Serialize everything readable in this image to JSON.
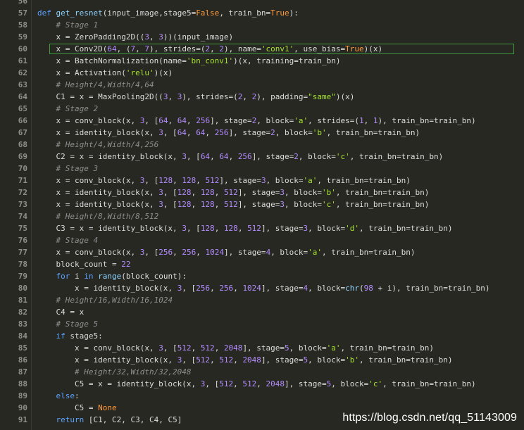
{
  "editor": {
    "lines": [
      {
        "num": "56",
        "tokens": []
      },
      {
        "num": "57",
        "tokens": [
          [
            "k",
            "def "
          ],
          [
            "f",
            "get_resnet"
          ],
          [
            "p",
            "(input_image,stage5="
          ],
          [
            "b",
            "False"
          ],
          [
            "p",
            ", train_bn="
          ],
          [
            "b",
            "True"
          ],
          [
            "p",
            "):"
          ]
        ]
      },
      {
        "num": "58",
        "tokens": [
          [
            "p",
            "    "
          ],
          [
            "c",
            "# Stage 1"
          ]
        ]
      },
      {
        "num": "59",
        "tokens": [
          [
            "p",
            "    x = ZeroPadding2D(("
          ],
          [
            "n",
            "3"
          ],
          [
            "p",
            ", "
          ],
          [
            "n",
            "3"
          ],
          [
            "p",
            "))(input_image)"
          ]
        ]
      },
      {
        "num": "60",
        "highlight": true,
        "tokens": [
          [
            "p",
            "    x = Conv2D("
          ],
          [
            "n",
            "64"
          ],
          [
            "p",
            ", ("
          ],
          [
            "n",
            "7"
          ],
          [
            "p",
            ", "
          ],
          [
            "n",
            "7"
          ],
          [
            "p",
            "), strides=("
          ],
          [
            "n",
            "2"
          ],
          [
            "p",
            ", "
          ],
          [
            "n",
            "2"
          ],
          [
            "p",
            "), name="
          ],
          [
            "s",
            "'conv1'"
          ],
          [
            "p",
            ", use_bias="
          ],
          [
            "b",
            "True"
          ],
          [
            "p",
            ")(x)"
          ]
        ]
      },
      {
        "num": "61",
        "tokens": [
          [
            "p",
            "    x = BatchNormalization(name="
          ],
          [
            "s",
            "'bn_conv1'"
          ],
          [
            "p",
            ")(x, training=train_bn)"
          ]
        ]
      },
      {
        "num": "62",
        "tokens": [
          [
            "p",
            "    x = Activation("
          ],
          [
            "s",
            "'relu'"
          ],
          [
            "p",
            ")(x)"
          ]
        ]
      },
      {
        "num": "63",
        "tokens": [
          [
            "p",
            "    "
          ],
          [
            "c",
            "# Height/4,Width/4,64"
          ]
        ]
      },
      {
        "num": "64",
        "tokens": [
          [
            "p",
            "    C1 = x = MaxPooling2D(("
          ],
          [
            "n",
            "3"
          ],
          [
            "p",
            ", "
          ],
          [
            "n",
            "3"
          ],
          [
            "p",
            "), strides=("
          ],
          [
            "n",
            "2"
          ],
          [
            "p",
            ", "
          ],
          [
            "n",
            "2"
          ],
          [
            "p",
            "), padding="
          ],
          [
            "s",
            "\"same\""
          ],
          [
            "p",
            ")(x)"
          ]
        ]
      },
      {
        "num": "65",
        "tokens": [
          [
            "p",
            "    "
          ],
          [
            "c",
            "# Stage 2"
          ]
        ]
      },
      {
        "num": "66",
        "tokens": [
          [
            "p",
            "    x = conv_block(x, "
          ],
          [
            "n",
            "3"
          ],
          [
            "p",
            ", ["
          ],
          [
            "n",
            "64"
          ],
          [
            "p",
            ", "
          ],
          [
            "n",
            "64"
          ],
          [
            "p",
            ", "
          ],
          [
            "n",
            "256"
          ],
          [
            "p",
            "], stage="
          ],
          [
            "n",
            "2"
          ],
          [
            "p",
            ", block="
          ],
          [
            "s",
            "'a'"
          ],
          [
            "p",
            ", strides=("
          ],
          [
            "n",
            "1"
          ],
          [
            "p",
            ", "
          ],
          [
            "n",
            "1"
          ],
          [
            "p",
            "), train_bn=train_bn)"
          ]
        ]
      },
      {
        "num": "67",
        "tokens": [
          [
            "p",
            "    x = identity_block(x, "
          ],
          [
            "n",
            "3"
          ],
          [
            "p",
            ", ["
          ],
          [
            "n",
            "64"
          ],
          [
            "p",
            ", "
          ],
          [
            "n",
            "64"
          ],
          [
            "p",
            ", "
          ],
          [
            "n",
            "256"
          ],
          [
            "p",
            "], stage="
          ],
          [
            "n",
            "2"
          ],
          [
            "p",
            ", block="
          ],
          [
            "s",
            "'b'"
          ],
          [
            "p",
            ", train_bn=train_bn)"
          ]
        ]
      },
      {
        "num": "68",
        "tokens": [
          [
            "p",
            "    "
          ],
          [
            "c",
            "# Height/4,Width/4,256"
          ]
        ]
      },
      {
        "num": "69",
        "tokens": [
          [
            "p",
            "    C2 = x = identity_block(x, "
          ],
          [
            "n",
            "3"
          ],
          [
            "p",
            ", ["
          ],
          [
            "n",
            "64"
          ],
          [
            "p",
            ", "
          ],
          [
            "n",
            "64"
          ],
          [
            "p",
            ", "
          ],
          [
            "n",
            "256"
          ],
          [
            "p",
            "], stage="
          ],
          [
            "n",
            "2"
          ],
          [
            "p",
            ", block="
          ],
          [
            "s",
            "'c'"
          ],
          [
            "p",
            ", train_bn=train_bn)"
          ]
        ]
      },
      {
        "num": "70",
        "tokens": [
          [
            "p",
            "    "
          ],
          [
            "c",
            "# Stage 3"
          ]
        ]
      },
      {
        "num": "71",
        "tokens": [
          [
            "p",
            "    x = conv_block(x, "
          ],
          [
            "n",
            "3"
          ],
          [
            "p",
            ", ["
          ],
          [
            "n",
            "128"
          ],
          [
            "p",
            ", "
          ],
          [
            "n",
            "128"
          ],
          [
            "p",
            ", "
          ],
          [
            "n",
            "512"
          ],
          [
            "p",
            "], stage="
          ],
          [
            "n",
            "3"
          ],
          [
            "p",
            ", block="
          ],
          [
            "s",
            "'a'"
          ],
          [
            "p",
            ", train_bn=train_bn)"
          ]
        ]
      },
      {
        "num": "72",
        "tokens": [
          [
            "p",
            "    x = identity_block(x, "
          ],
          [
            "n",
            "3"
          ],
          [
            "p",
            ", ["
          ],
          [
            "n",
            "128"
          ],
          [
            "p",
            ", "
          ],
          [
            "n",
            "128"
          ],
          [
            "p",
            ", "
          ],
          [
            "n",
            "512"
          ],
          [
            "p",
            "], stage="
          ],
          [
            "n",
            "3"
          ],
          [
            "p",
            ", block="
          ],
          [
            "s",
            "'b'"
          ],
          [
            "p",
            ", train_bn=train_bn)"
          ]
        ]
      },
      {
        "num": "73",
        "tokens": [
          [
            "p",
            "    x = identity_block(x, "
          ],
          [
            "n",
            "3"
          ],
          [
            "p",
            ", ["
          ],
          [
            "n",
            "128"
          ],
          [
            "p",
            ", "
          ],
          [
            "n",
            "128"
          ],
          [
            "p",
            ", "
          ],
          [
            "n",
            "512"
          ],
          [
            "p",
            "], stage="
          ],
          [
            "n",
            "3"
          ],
          [
            "p",
            ", block="
          ],
          [
            "s",
            "'c'"
          ],
          [
            "p",
            ", train_bn=train_bn)"
          ]
        ]
      },
      {
        "num": "74",
        "tokens": [
          [
            "p",
            "    "
          ],
          [
            "c",
            "# Height/8,Width/8,512"
          ]
        ]
      },
      {
        "num": "75",
        "tokens": [
          [
            "p",
            "    C3 = x = identity_block(x, "
          ],
          [
            "n",
            "3"
          ],
          [
            "p",
            ", ["
          ],
          [
            "n",
            "128"
          ],
          [
            "p",
            ", "
          ],
          [
            "n",
            "128"
          ],
          [
            "p",
            ", "
          ],
          [
            "n",
            "512"
          ],
          [
            "p",
            "], stage="
          ],
          [
            "n",
            "3"
          ],
          [
            "p",
            ", block="
          ],
          [
            "s",
            "'d'"
          ],
          [
            "p",
            ", train_bn=train_bn)"
          ]
        ]
      },
      {
        "num": "76",
        "tokens": [
          [
            "p",
            "    "
          ],
          [
            "c",
            "# Stage 4"
          ]
        ]
      },
      {
        "num": "77",
        "tokens": [
          [
            "p",
            "    x = conv_block(x, "
          ],
          [
            "n",
            "3"
          ],
          [
            "p",
            ", ["
          ],
          [
            "n",
            "256"
          ],
          [
            "p",
            ", "
          ],
          [
            "n",
            "256"
          ],
          [
            "p",
            ", "
          ],
          [
            "n",
            "1024"
          ],
          [
            "p",
            "], stage="
          ],
          [
            "n",
            "4"
          ],
          [
            "p",
            ", block="
          ],
          [
            "s",
            "'a'"
          ],
          [
            "p",
            ", train_bn=train_bn)"
          ]
        ]
      },
      {
        "num": "78",
        "tokens": [
          [
            "p",
            "    block_count = "
          ],
          [
            "n",
            "22"
          ]
        ]
      },
      {
        "num": "79",
        "tokens": [
          [
            "p",
            "    "
          ],
          [
            "k",
            "for"
          ],
          [
            "p",
            " i "
          ],
          [
            "k",
            "in"
          ],
          [
            "p",
            " "
          ],
          [
            "f",
            "range"
          ],
          [
            "p",
            "(block_count):"
          ]
        ]
      },
      {
        "num": "80",
        "tokens": [
          [
            "p",
            "        x = identity_block(x, "
          ],
          [
            "n",
            "3"
          ],
          [
            "p",
            ", ["
          ],
          [
            "n",
            "256"
          ],
          [
            "p",
            ", "
          ],
          [
            "n",
            "256"
          ],
          [
            "p",
            ", "
          ],
          [
            "n",
            "1024"
          ],
          [
            "p",
            "], stage="
          ],
          [
            "n",
            "4"
          ],
          [
            "p",
            ", block="
          ],
          [
            "f",
            "chr"
          ],
          [
            "p",
            "("
          ],
          [
            "n",
            "98"
          ],
          [
            "p",
            " + i), train_bn=train_bn)"
          ]
        ]
      },
      {
        "num": "81",
        "tokens": [
          [
            "p",
            "    "
          ],
          [
            "c",
            "# Height/16,Width/16,1024"
          ]
        ]
      },
      {
        "num": "82",
        "tokens": [
          [
            "p",
            "    C4 = x"
          ]
        ]
      },
      {
        "num": "83",
        "tokens": [
          [
            "p",
            "    "
          ],
          [
            "c",
            "# Stage 5"
          ]
        ]
      },
      {
        "num": "84",
        "tokens": [
          [
            "p",
            "    "
          ],
          [
            "k",
            "if"
          ],
          [
            "p",
            " stage5:"
          ]
        ]
      },
      {
        "num": "85",
        "tokens": [
          [
            "p",
            "        x = conv_block(x, "
          ],
          [
            "n",
            "3"
          ],
          [
            "p",
            ", ["
          ],
          [
            "n",
            "512"
          ],
          [
            "p",
            ", "
          ],
          [
            "n",
            "512"
          ],
          [
            "p",
            ", "
          ],
          [
            "n",
            "2048"
          ],
          [
            "p",
            "], stage="
          ],
          [
            "n",
            "5"
          ],
          [
            "p",
            ", block="
          ],
          [
            "s",
            "'a'"
          ],
          [
            "p",
            ", train_bn=train_bn)"
          ]
        ]
      },
      {
        "num": "86",
        "tokens": [
          [
            "p",
            "        x = identity_block(x, "
          ],
          [
            "n",
            "3"
          ],
          [
            "p",
            ", ["
          ],
          [
            "n",
            "512"
          ],
          [
            "p",
            ", "
          ],
          [
            "n",
            "512"
          ],
          [
            "p",
            ", "
          ],
          [
            "n",
            "2048"
          ],
          [
            "p",
            "], stage="
          ],
          [
            "n",
            "5"
          ],
          [
            "p",
            ", block="
          ],
          [
            "s",
            "'b'"
          ],
          [
            "p",
            ", train_bn=train_bn)"
          ]
        ]
      },
      {
        "num": "87",
        "tokens": [
          [
            "p",
            "        "
          ],
          [
            "c",
            "# Height/32,Width/32,2048"
          ]
        ]
      },
      {
        "num": "88",
        "tokens": [
          [
            "p",
            "        C5 = x = identity_block(x, "
          ],
          [
            "n",
            "3"
          ],
          [
            "p",
            ", ["
          ],
          [
            "n",
            "512"
          ],
          [
            "p",
            ", "
          ],
          [
            "n",
            "512"
          ],
          [
            "p",
            ", "
          ],
          [
            "n",
            "2048"
          ],
          [
            "p",
            "], stage="
          ],
          [
            "n",
            "5"
          ],
          [
            "p",
            ", block="
          ],
          [
            "s",
            "'c'"
          ],
          [
            "p",
            ", train_bn=train_bn)"
          ]
        ]
      },
      {
        "num": "89",
        "tokens": [
          [
            "p",
            "    "
          ],
          [
            "k",
            "else"
          ],
          [
            "p",
            ":"
          ]
        ]
      },
      {
        "num": "90",
        "tokens": [
          [
            "p",
            "        C5 = "
          ],
          [
            "b",
            "None"
          ]
        ]
      },
      {
        "num": "91",
        "tokens": [
          [
            "p",
            "    "
          ],
          [
            "k",
            "return"
          ],
          [
            "p",
            " [C1, C2, C3, C4, C5]"
          ]
        ]
      }
    ]
  },
  "watermark": "https://blog.csdn.net/qq_51143009",
  "colors": {
    "background": "#272822",
    "keyword": "#5aa0ff",
    "function": "#8fd3ff",
    "boolean": "#ff9a3c",
    "number": "#b38cff",
    "string": "#a6e22e",
    "comment": "#8e8e8e",
    "highlight_border": "#3d9c3d"
  }
}
